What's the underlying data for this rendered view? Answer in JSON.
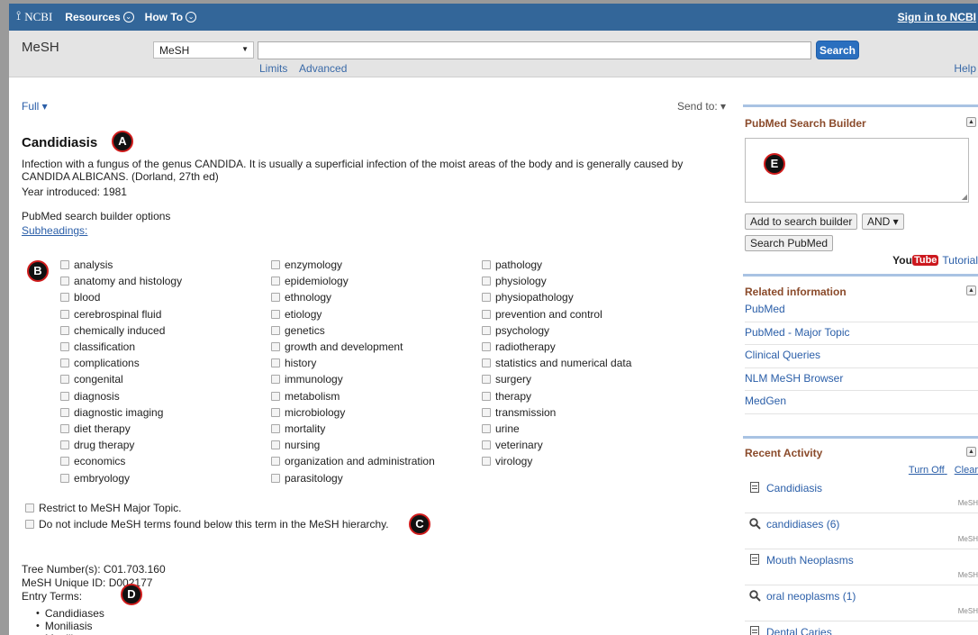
{
  "topbar": {
    "logo_mark": "⟟",
    "logo": "NCBI",
    "resources": "Resources",
    "howto": "How To",
    "menu_icon": "⌄",
    "signin": "Sign in to NCBI"
  },
  "search": {
    "db_title": "MeSH",
    "db_select": "MeSH",
    "select_arrow": "▼",
    "term": "",
    "button": "Search",
    "limits": "Limits",
    "advanced": "Advanced",
    "help": "Help"
  },
  "main": {
    "full": "Full ▾",
    "send_to": "Send to: ▾",
    "title": "Candidiasis",
    "scope_note": "Infection with a fungus of the genus CANDIDA. It is usually a superficial infection of the moist areas of the body and is generally caused by CANDIDA ALBICANS. (Dorland, 27th ed)",
    "year": "Year introduced: 1981",
    "builder_options": "PubMed search builder options",
    "subheadings": "Subheadings:",
    "subheadings_col1": [
      "analysis",
      "anatomy and histology",
      "blood",
      "cerebrospinal fluid",
      "chemically induced",
      "classification",
      "complications",
      "congenital",
      "diagnosis",
      "diagnostic imaging",
      "diet therapy",
      "drug therapy",
      "economics",
      "embryology"
    ],
    "subheadings_col2": [
      "enzymology",
      "epidemiology",
      "ethnology",
      "etiology",
      "genetics",
      "growth and development",
      "history",
      "immunology",
      "metabolism",
      "microbiology",
      "mortality",
      "nursing",
      "organization and administration",
      "parasitology"
    ],
    "subheadings_col3": [
      "pathology",
      "physiology",
      "physiopathology",
      "prevention and control",
      "psychology",
      "radiotherapy",
      "statistics and numerical data",
      "surgery",
      "therapy",
      "transmission",
      "urine",
      "veterinary",
      "virology"
    ],
    "restrict_major": "Restrict to MeSH Major Topic.",
    "no_explode": "Do not include MeSH terms found below this term in the MeSH hierarchy.",
    "tree_number": "Tree Number(s): C01.703.160",
    "unique_id": "MeSH Unique ID: D002177",
    "entry_terms_label": "Entry Terms:",
    "entry_terms": [
      "Candidiases",
      "Moniliasis",
      "Moniliases"
    ]
  },
  "markers": {
    "a": "A",
    "b": "B",
    "c": "C",
    "d": "D",
    "e": "E"
  },
  "sidebar": {
    "builder_title": "PubMed Search Builder",
    "add_button": "Add to search builder",
    "operator": "AND ▾",
    "search_pubmed": "Search PubMed",
    "youtube_you": "You",
    "youtube_tube": "Tube",
    "tutorial": "Tutorial",
    "collapse_icon": "▲",
    "related_title": "Related information",
    "related": [
      "PubMed",
      "PubMed - Major Topic",
      "Clinical Queries",
      "NLM MeSH Browser",
      "MedGen"
    ],
    "recent_title": "Recent Activity",
    "turn_off": "Turn Off",
    "clear": "Clear",
    "recent": [
      {
        "icon": "doc-icon",
        "label": "Candidiasis",
        "source": "MeSH"
      },
      {
        "icon": "search-icon",
        "label": "candidiases (6)",
        "source": "MeSH"
      },
      {
        "icon": "doc-icon",
        "label": "Mouth Neoplasms",
        "source": "MeSH"
      },
      {
        "icon": "search-icon",
        "label": "oral neoplasms (1)",
        "source": "MeSH"
      },
      {
        "icon": "doc-icon",
        "label": "Dental Caries",
        "source": ""
      }
    ]
  }
}
